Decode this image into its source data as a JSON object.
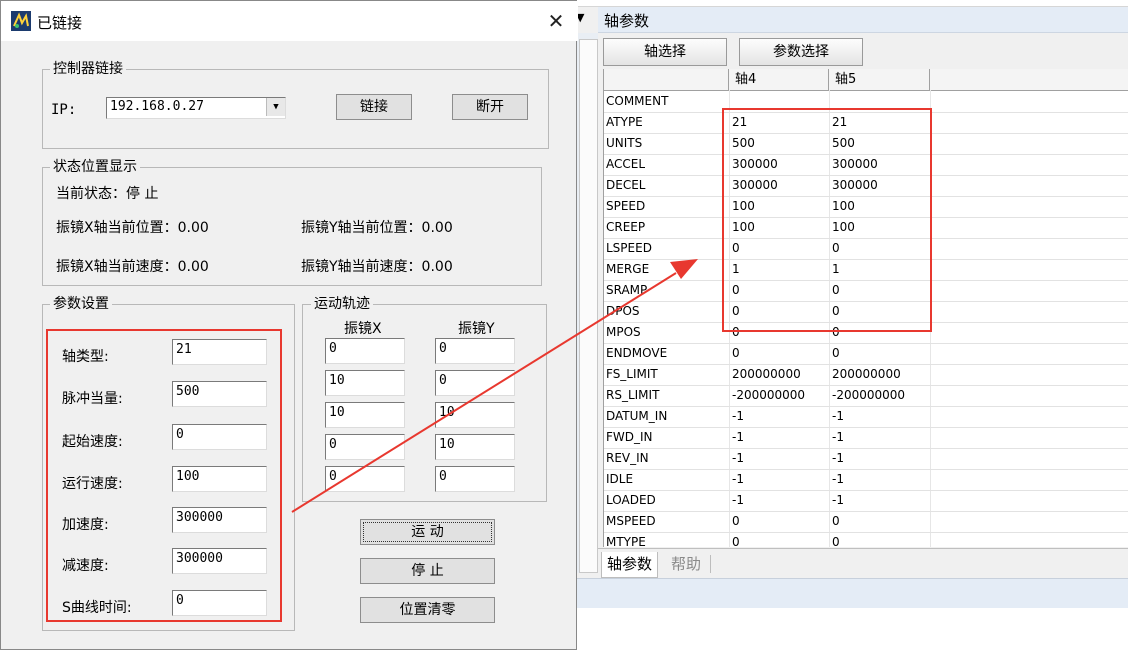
{
  "dialog": {
    "title": "已链接",
    "controller_group": {
      "label": "控制器链接",
      "ip_label": "IP:",
      "ip_value": "192.168.0.27",
      "connect_label": "链接",
      "disconnect_label": "断开"
    },
    "status_group": {
      "label": "状态位置显示",
      "current_state": "当前状态：停  止",
      "x_pos": "振镜X轴当前位置：0.00",
      "y_pos": "振镜Y轴当前位置：0.00",
      "x_speed": "振镜X轴当前速度：0.00",
      "y_speed": "振镜Y轴当前速度：0.00"
    },
    "param_group": {
      "label": "参数设置",
      "rows": [
        {
          "label": "轴类型:",
          "value": "21"
        },
        {
          "label": "脉冲当量:",
          "value": "500"
        },
        {
          "label": "起始速度:",
          "value": "0"
        },
        {
          "label": "运行速度:",
          "value": "100"
        },
        {
          "label": "加速度:",
          "value": "300000"
        },
        {
          "label": "减速度:",
          "value": "300000"
        },
        {
          "label": "S曲线时间:",
          "value": "0"
        }
      ]
    },
    "trajectory_group": {
      "label": "运动轨迹",
      "col_x": "振镜X",
      "col_y": "振镜Y",
      "x_values": [
        "0",
        "10",
        "10",
        "0",
        "0"
      ],
      "y_values": [
        "0",
        "0",
        "10",
        "10",
        "0"
      ]
    },
    "buttons": {
      "move": "运  动",
      "stop": "停  止",
      "zero": "位置清零"
    }
  },
  "axis_panel": {
    "title": "轴参数",
    "toolbar": {
      "axis_select": "轴选择",
      "param_select": "参数选择"
    },
    "columns": [
      "",
      "轴4",
      "轴5"
    ],
    "rows": [
      {
        "name": "COMMENT",
        "a4": "",
        "a5": ""
      },
      {
        "name": "ATYPE",
        "a4": "21",
        "a5": "21"
      },
      {
        "name": "UNITS",
        "a4": "500",
        "a5": "500"
      },
      {
        "name": "ACCEL",
        "a4": "300000",
        "a5": "300000"
      },
      {
        "name": "DECEL",
        "a4": "300000",
        "a5": "300000"
      },
      {
        "name": "SPEED",
        "a4": "100",
        "a5": "100"
      },
      {
        "name": "CREEP",
        "a4": "100",
        "a5": "100"
      },
      {
        "name": "LSPEED",
        "a4": "0",
        "a5": "0"
      },
      {
        "name": "MERGE",
        "a4": "1",
        "a5": "1"
      },
      {
        "name": "SRAMP",
        "a4": "0",
        "a5": "0"
      },
      {
        "name": "DPOS",
        "a4": "0",
        "a5": "0"
      },
      {
        "name": "MPOS",
        "a4": "0",
        "a5": "0"
      },
      {
        "name": "ENDMOVE",
        "a4": "0",
        "a5": "0"
      },
      {
        "name": "FS_LIMIT",
        "a4": "200000000",
        "a5": "200000000"
      },
      {
        "name": "RS_LIMIT",
        "a4": "-200000000",
        "a5": "-200000000"
      },
      {
        "name": "DATUM_IN",
        "a4": "-1",
        "a5": "-1"
      },
      {
        "name": "FWD_IN",
        "a4": "-1",
        "a5": "-1"
      },
      {
        "name": "REV_IN",
        "a4": "-1",
        "a5": "-1"
      },
      {
        "name": "IDLE",
        "a4": "-1",
        "a5": "-1"
      },
      {
        "name": "LOADED",
        "a4": "-1",
        "a5": "-1"
      },
      {
        "name": "MSPEED",
        "a4": "0",
        "a5": "0"
      },
      {
        "name": "MTYPE",
        "a4": "0",
        "a5": "0"
      }
    ],
    "tabs": [
      "轴参数",
      "帮助"
    ]
  },
  "annotation_color": "#e8382f"
}
